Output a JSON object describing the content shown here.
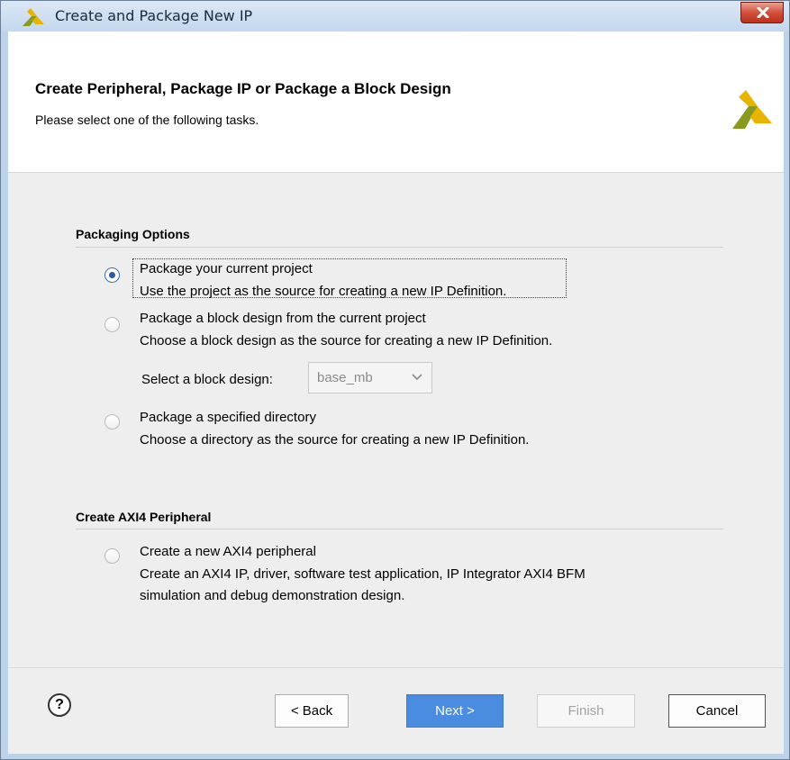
{
  "window": {
    "title": "Create and Package New IP",
    "close_icon": "close-x-icon",
    "colors": {
      "close_button": "#c8452f",
      "accent": "#4a8de0",
      "logo_yellow": "#e8b400",
      "logo_green": "#8a9a1e"
    }
  },
  "header": {
    "title": "Create Peripheral, Package IP or Package a Block Design",
    "subtitle": "Please select one of the following tasks."
  },
  "packaging": {
    "section_title": "Packaging Options",
    "options": [
      {
        "label": "Package your current project",
        "description": "Use the project as the source for creating a new IP Definition.",
        "selected": true
      },
      {
        "label": "Package a block design from the current project",
        "description": "Choose a block design as the source for creating a new IP Definition.",
        "selected": false
      },
      {
        "label": "Package a specified directory",
        "description": "Choose a directory as the source for creating a new IP Definition.",
        "selected": false
      }
    ],
    "block_design_select": {
      "label": "Select a block design:",
      "value": "base_mb",
      "enabled": false
    }
  },
  "axi": {
    "section_title": "Create AXI4 Peripheral",
    "option": {
      "label": "Create a new AXI4 peripheral",
      "description_line1": "Create an AXI4 IP, driver, software test application, IP Integrator AXI4 BFM",
      "description_line2": "simulation and debug demonstration design.",
      "selected": false
    }
  },
  "footer": {
    "help_label": "?",
    "back_label": "< Back",
    "next_label": "Next >",
    "finish_label": "Finish",
    "cancel_label": "Cancel"
  }
}
